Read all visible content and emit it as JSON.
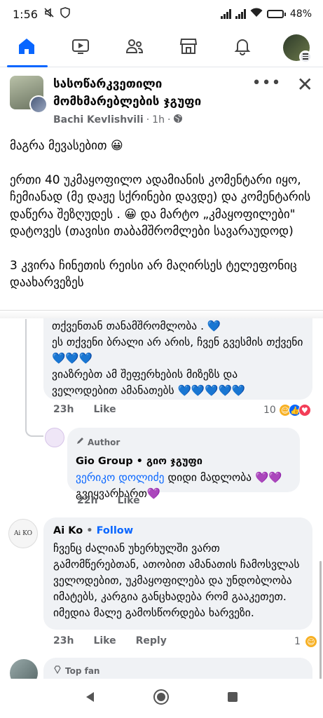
{
  "status": {
    "time": "1:56",
    "battery": "48%",
    "battery_level": 0.48
  },
  "nav": {
    "icons": [
      "home-icon",
      "video-icon",
      "friends-icon",
      "marketplace-icon",
      "notifications-icon",
      "profile-menu-icon"
    ]
  },
  "post": {
    "group_name": "სასოწარკვეთილი მომხმარებლების ჯგუფი",
    "author": "Bachi Kevlishvili",
    "time": "1h",
    "paragraphs": [
      "მაგრა მევასებით 😀",
      "ერთი 40 უკმაყოფილო ადამიანის კომენტარი იყო, ჩემიანად (მე დაჟე სქრინები დავდე) და კომენტარის დაწერა შეზღუდეს . 😀 და მარტო „კმაყოფილები\" დატოვეს (თავისი თაბამშრომლები სავარაუდოდ)",
      "3 კვირა ჩინეთის რეისი არ მაღირსეს ტელეფონიც დაახარვეზეს"
    ]
  },
  "comments": [
    {
      "lines": [
        "თქვენთან თანამშრომლობა  . 💙",
        "ეს თქვენი ბრალი არ არის, ჩვენ გვესმის თქვენი  💙💙💙",
        "ვიაზრებთ ამ შეფერხების მიზეზს და ველოდებით ამანათებს 💙💙💙💙💙"
      ],
      "time": "23h",
      "like": "Like",
      "reaction_count": "10"
    },
    {
      "badge": "Author",
      "name": "Gio Group • გიო ჯგუფი",
      "mention": "ვერიკო დოლიძე",
      "text": " დიდი მადლობა 💜💜 გვიყვარხართ💜",
      "time": "22h",
      "like": "Like"
    },
    {
      "name": "Ai Ko",
      "follow": "Follow",
      "avatar_text": "Ai KO",
      "text": "ჩვენც ძალიან უხერხულში ვართ გამომწერებთან, ათობით ამანათის ჩამოსვლას ველოდებით, უკმაყოფილება და უნდობლობა იმატებს, კარგია განცხადება რომ გააკეთეთ. იმედია მალე გამოსწორდება ხარვეზი.",
      "time": "23h",
      "like": "Like",
      "reply": "Reply",
      "reaction_count": "1"
    },
    {
      "badge": "Top fan"
    }
  ],
  "colors": {
    "accent": "#0866ff",
    "bubble": "#f0f2f5",
    "muted": "#65676b"
  }
}
